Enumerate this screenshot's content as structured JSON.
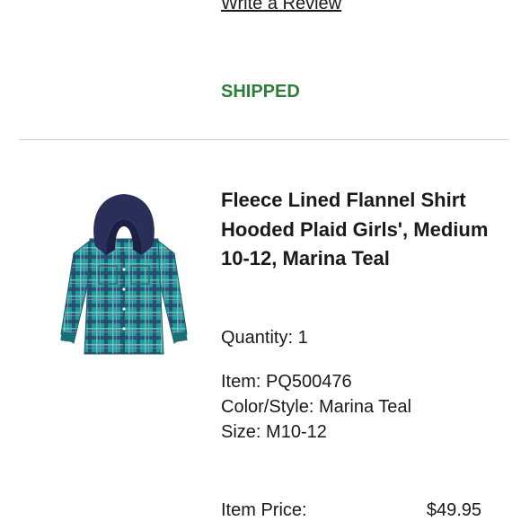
{
  "order": {
    "write_review_label": "Write a Review",
    "status_label": "SHIPPED"
  },
  "product": {
    "title": "Fleece Lined Flannel Shirt Hooded Plaid Girls', Medium 10-12, Marina Teal",
    "quantity_label": "Quantity:",
    "quantity_value": "1",
    "item_label": "Item:",
    "item_value": "PQ500476",
    "color_label": "Color/Style:",
    "color_value": "Marina Teal",
    "size_label": "Size:",
    "size_value": "M10-12",
    "price_label": "Item Price:",
    "price_value": "$49.95",
    "image_icon": "hooded-flannel-shirt-image"
  },
  "colors": {
    "status_green": "#2e7d3a",
    "shirt_teal": "#1f9c97",
    "hood_navy": "#2a2f5a"
  }
}
